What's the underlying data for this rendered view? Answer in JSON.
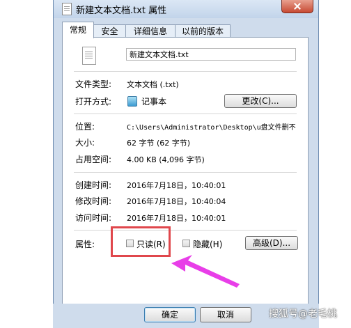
{
  "window": {
    "title": "新建文本文档.txt 属性"
  },
  "tabs": [
    {
      "label": "常规"
    },
    {
      "label": "安全"
    },
    {
      "label": "详细信息"
    },
    {
      "label": "以前的版本"
    }
  ],
  "general": {
    "filename": "新建文本文档.txt",
    "type_label": "文件类型:",
    "type_value": "文本文档 (.txt)",
    "open_label": "打开方式:",
    "open_value": "记事本",
    "change_button": "更改(C)...",
    "location_label": "位置:",
    "location_value": "C:\\Users\\Administrator\\Desktop\\u盘文件删不",
    "size_label": "大小:",
    "size_value": "62 字节 (62 字节)",
    "disk_label": "占用空间:",
    "disk_value": "4.00 KB (4,096 字节)",
    "created_label": "创建时间:",
    "created_value": "2016年7月18日，10:40:01",
    "modified_label": "修改时间:",
    "modified_value": "2016年7月18日，10:40:04",
    "accessed_label": "访问时间:",
    "accessed_value": "2016年7月18日，10:40:01",
    "attributes_label": "属性:",
    "readonly_label": "只读(R)",
    "hidden_label": "隐藏(H)",
    "advanced_button": "高级(D)..."
  },
  "footer": {
    "ok": "确定",
    "cancel": "取消"
  },
  "watermark": "搜狐号@老毛桃",
  "colors": {
    "highlight_box": "#e0474c",
    "arrow": "#e83ee8"
  }
}
